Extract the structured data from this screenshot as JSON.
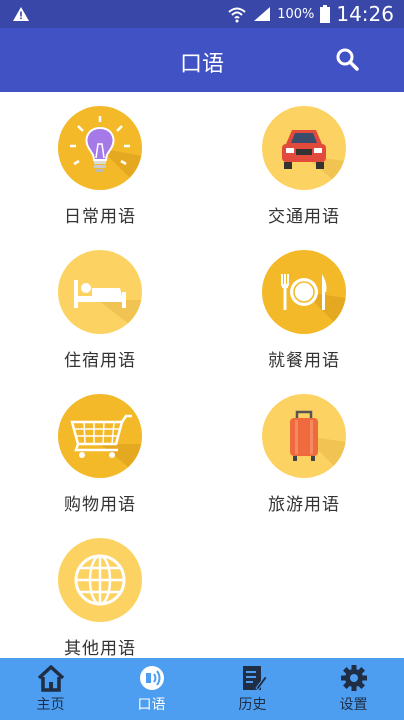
{
  "status_bar": {
    "battery": "100%",
    "time": "14:26"
  },
  "app_bar": {
    "title": "口语"
  },
  "categories": [
    {
      "label": "日常用语",
      "icon": "lightbulb-icon"
    },
    {
      "label": "交通用语",
      "icon": "car-icon"
    },
    {
      "label": "住宿用语",
      "icon": "bed-icon"
    },
    {
      "label": "就餐用语",
      "icon": "dining-icon"
    },
    {
      "label": "购物用语",
      "icon": "shopping-cart-icon"
    },
    {
      "label": "旅游用语",
      "icon": "suitcase-icon"
    },
    {
      "label": "其他用语",
      "icon": "globe-icon"
    }
  ],
  "bottom_nav": [
    {
      "label": "主页",
      "icon": "home-icon",
      "active": false
    },
    {
      "label": "口语",
      "icon": "speech-icon",
      "active": true
    },
    {
      "label": "历史",
      "icon": "history-icon",
      "active": false
    },
    {
      "label": "设置",
      "icon": "gear-icon",
      "active": false
    }
  ],
  "colors": {
    "status_bar": "#3947a8",
    "app_bar": "#4052c4",
    "bottom_nav": "#4d9ef0",
    "circle_dark": "#f3b928",
    "circle_light": "#fcd262"
  }
}
